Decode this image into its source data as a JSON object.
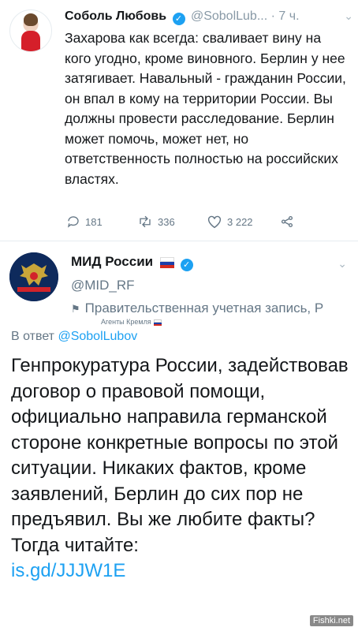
{
  "tweet1": {
    "name": "Соболь Любовь",
    "handle": "@SobolLub...",
    "time": "· 7 ч.",
    "text": "Захарова как всегда: сваливает вину на кого угодно, кроме виновного. Берлин у нее затягивает. Навальный - гражданин России, он впал в кому на территории России. Вы должны провести расследование. Берлин может помочь, может нет, но ответственность полностью на российских властях.",
    "replies": "181",
    "retweets": "336",
    "likes": "3 222"
  },
  "tweet2": {
    "name": "МИД России",
    "handle": "@MID_RF",
    "gov_label": "Правительственная учетная запись, Р",
    "agents_label": "Агенты Кремля",
    "reply_prefix": "В ответ",
    "reply_to": "@SobolLubov",
    "text": "Генпрокуратура России, задействовав договор о правовой помощи, официально направила германской стороне конкретные вопросы по этой ситуации. Никаких фактов, кроме заявлений, Берлин до сих пор не предъявил. Вы же любите факты? Тогда читайте:",
    "link": "is.gd/JJJW1E"
  },
  "watermark": "Fishki.net",
  "icons": {
    "verified": "verified-badge-icon",
    "chevron": "chevron-down-icon",
    "reply": "reply-icon",
    "retweet": "retweet-icon",
    "like": "heart-icon",
    "share": "share-icon",
    "gov": "government-flag-icon"
  },
  "colors": {
    "accent": "#1da1f2",
    "muted": "#657786",
    "text": "#14171a"
  }
}
